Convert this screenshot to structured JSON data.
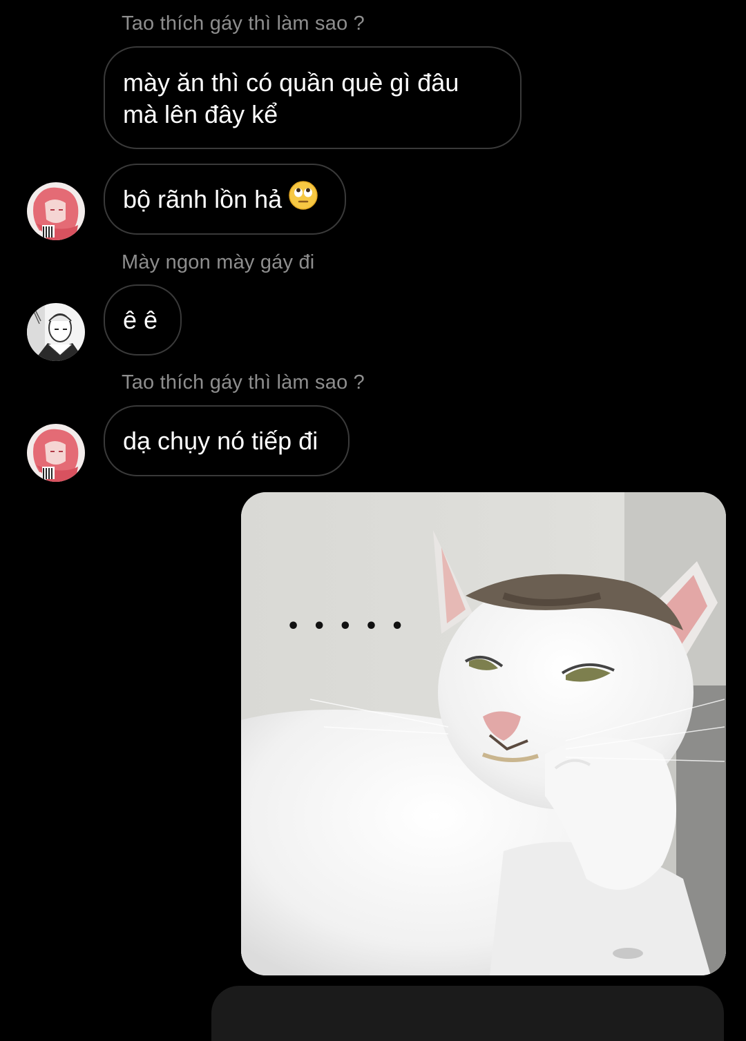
{
  "thread": {
    "messages": [
      {
        "reply_to": "Tao thích gáy thì làm sao ?",
        "lines": [
          "mày ăn thì có quần què gì đâu",
          "mà lên đây kể"
        ]
      },
      {
        "text": "bộ rãnh lồn hả",
        "emoji": "face-with-rolling-eyes-icon",
        "avatar": "red-haired-anime-avatar"
      },
      {
        "reply_to": "Mày ngon mày gáy đi",
        "text": "ê ê",
        "avatar": "monochrome-manga-avatar"
      },
      {
        "reply_to": "Tao thích gáy thì làm sao ?",
        "text": "dạ chụy nó tiếp đi",
        "avatar": "red-haired-anime-avatar"
      },
      {
        "image": "unimpressed-white-cat-meme",
        "image_text": "• • • • •"
      }
    ]
  },
  "colors": {
    "background": "#000000",
    "bubble_border": "#3a3a3a",
    "reply_text": "#8e8e8e",
    "message_text": "#ffffff"
  }
}
